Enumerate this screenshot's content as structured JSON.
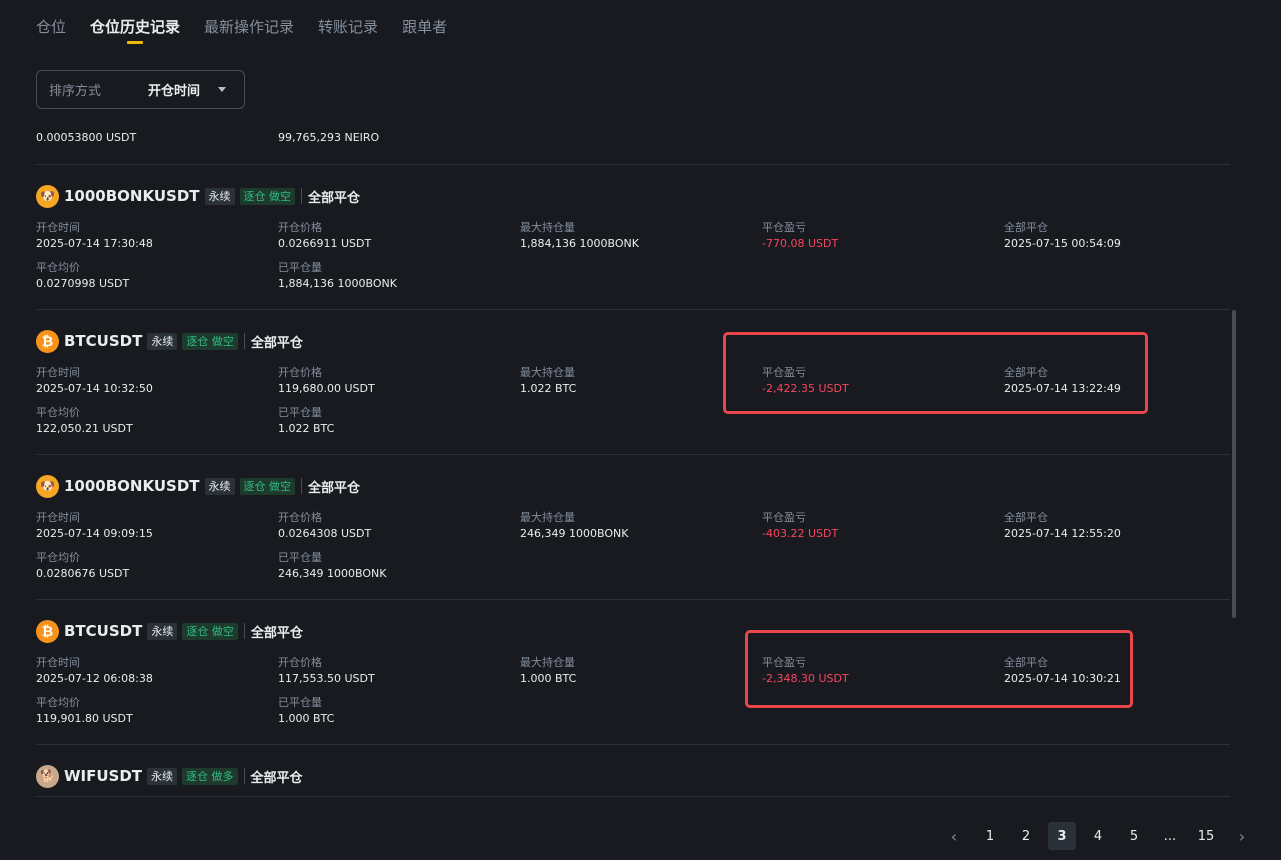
{
  "tabs": [
    "仓位",
    "仓位历史记录",
    "最新操作记录",
    "转账记录",
    "跟单者"
  ],
  "sort": {
    "label": "排序方式",
    "value": "开仓时间"
  },
  "partial_row": {
    "col1": "0.00053800 USDT",
    "col2": "99,765,293 NEIRO"
  },
  "labels": {
    "open_time": "开仓时间",
    "open_price": "开仓价格",
    "max_pos": "最大持仓量",
    "pnl": "平仓盈亏",
    "close_all": "全部平仓",
    "close_avg": "平仓均价",
    "closed_qty": "已平仓量"
  },
  "positions": [
    {
      "symbol": "1000BONKUSDT",
      "icon": "bonk-coin-icon",
      "type": "永续",
      "mode": "逐仓 做空",
      "status": "全部平仓",
      "open_time": "2025-07-14 17:30:48",
      "open_price": "0.0266911 USDT",
      "max_pos": "1,884,136 1000BONK",
      "pnl": "-770.08 USDT",
      "close_time": "2025-07-15 00:54:09",
      "close_avg": "0.0270998 USDT",
      "closed_qty": "1,884,136 1000BONK"
    },
    {
      "symbol": "BTCUSDT",
      "icon": "btc-coin-icon",
      "type": "永续",
      "mode": "逐仓 做空",
      "status": "全部平仓",
      "open_time": "2025-07-14 10:32:50",
      "open_price": "119,680.00 USDT",
      "max_pos": "1.022 BTC",
      "pnl": "-2,422.35 USDT",
      "close_time": "2025-07-14 13:22:49",
      "close_avg": "122,050.21 USDT",
      "closed_qty": "1.022 BTC"
    },
    {
      "symbol": "1000BONKUSDT",
      "icon": "bonk-coin-icon",
      "type": "永续",
      "mode": "逐仓 做空",
      "status": "全部平仓",
      "open_time": "2025-07-14 09:09:15",
      "open_price": "0.0264308 USDT",
      "max_pos": "246,349 1000BONK",
      "pnl": "-403.22 USDT",
      "close_time": "2025-07-14 12:55:20",
      "close_avg": "0.0280676 USDT",
      "closed_qty": "246,349 1000BONK"
    },
    {
      "symbol": "BTCUSDT",
      "icon": "btc-coin-icon",
      "type": "永续",
      "mode": "逐仓 做空",
      "status": "全部平仓",
      "open_time": "2025-07-12 06:08:38",
      "open_price": "117,553.50 USDT",
      "max_pos": "1.000 BTC",
      "pnl": "-2,348.30 USDT",
      "close_time": "2025-07-14 10:30:21",
      "close_avg": "119,901.80 USDT",
      "closed_qty": "1.000 BTC"
    }
  ],
  "last_row": {
    "symbol": "WIFUSDT",
    "icon": "wif-coin-icon",
    "type": "永续",
    "mode": "逐仓 做多",
    "status": "全部平仓"
  },
  "pagination": {
    "prev": "‹",
    "pages": [
      "1",
      "2",
      "3",
      "4",
      "5"
    ],
    "ellipsis": "...",
    "last": "15",
    "next": "›",
    "current": "3"
  },
  "colors": {
    "accent": "#f0b90b",
    "negative": "#f6465d",
    "positive": "#2ebd85",
    "highlight": "#e8474c"
  }
}
